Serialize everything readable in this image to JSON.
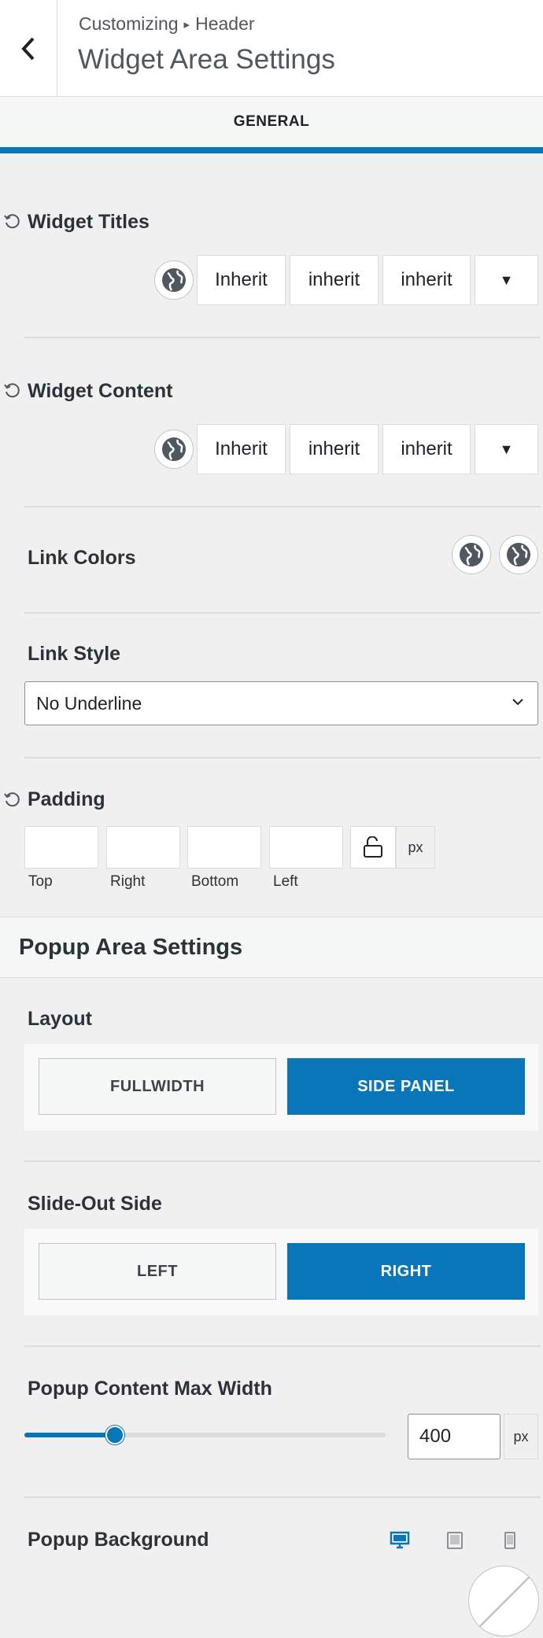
{
  "header": {
    "breadcrumb_root": "Customizing",
    "breadcrumb_separator": "▸",
    "breadcrumb_current": "Header",
    "title": "Widget Area Settings"
  },
  "tabs": [
    {
      "label": "GENERAL",
      "active": true
    }
  ],
  "widget_titles": {
    "label": "Widget Titles",
    "font_family": "Inherit",
    "font_weight": "inherit",
    "text_transform": "inherit",
    "more": "▼"
  },
  "widget_content": {
    "label": "Widget Content",
    "font_family": "Inherit",
    "font_weight": "inherit",
    "text_transform": "inherit",
    "more": "▼"
  },
  "link_colors": {
    "label": "Link Colors"
  },
  "link_style": {
    "label": "Link Style",
    "selected": "No Underline"
  },
  "padding": {
    "label": "Padding",
    "unit": "px",
    "fields": [
      {
        "label": "Top",
        "value": ""
      },
      {
        "label": "Right",
        "value": ""
      },
      {
        "label": "Bottom",
        "value": ""
      },
      {
        "label": "Left",
        "value": ""
      }
    ]
  },
  "popup_section": {
    "title": "Popup Area Settings"
  },
  "layout": {
    "label": "Layout",
    "options": [
      "FULLWIDTH",
      "SIDE PANEL"
    ],
    "selected": "SIDE PANEL"
  },
  "slide_out_side": {
    "label": "Slide-Out Side",
    "options": [
      "LEFT",
      "RIGHT"
    ],
    "selected": "RIGHT"
  },
  "popup_max_width": {
    "label": "Popup Content Max Width",
    "value": "400",
    "unit": "px",
    "slider_fraction": 0.25
  },
  "popup_background": {
    "label": "Popup Background"
  },
  "colors": {
    "accent": "#0a76ba",
    "text": "#2c3338",
    "bg": "#f0f0f1"
  }
}
